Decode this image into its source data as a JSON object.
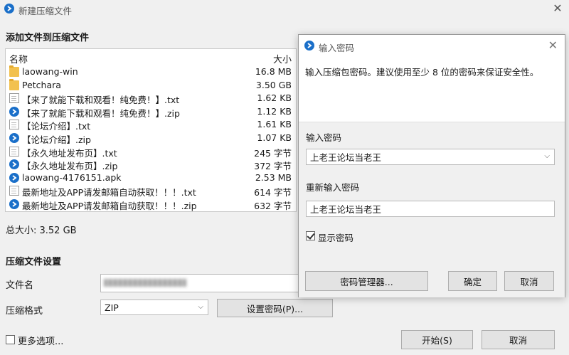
{
  "window": {
    "title": "新建压缩文件",
    "close_glyph": "✕"
  },
  "add_section": {
    "title": "添加文件到压缩文件"
  },
  "file_list": {
    "col_name": "名称",
    "col_size": "大小",
    "rows": [
      {
        "icon": "folder-icon",
        "name": "laowang-win",
        "size": "16.8 MB"
      },
      {
        "icon": "folder-icon",
        "name": "Petchara",
        "size": "3.50 GB"
      },
      {
        "icon": "text-file-icon",
        "name": "【来了就能下载和观看！纯免费！】.txt",
        "size": "1.62 KB"
      },
      {
        "icon": "zip-file-icon",
        "name": "【来了就能下载和观看！纯免费！】.zip",
        "size": "1.12 KB"
      },
      {
        "icon": "text-file-icon",
        "name": "【论坛介绍】.txt",
        "size": "1.61 KB"
      },
      {
        "icon": "zip-file-icon",
        "name": "【论坛介绍】.zip",
        "size": "1.07 KB"
      },
      {
        "icon": "text-file-icon",
        "name": "【永久地址发布页】.txt",
        "size": "245 字节"
      },
      {
        "icon": "zip-file-icon",
        "name": "【永久地址发布页】.zip",
        "size": "372 字节"
      },
      {
        "icon": "apk-file-icon",
        "name": "laowang-4176151.apk",
        "size": "2.53 MB"
      },
      {
        "icon": "text-file-icon",
        "name": "最新地址及APP请发邮箱自动获取！！！.txt",
        "size": "614 字节"
      },
      {
        "icon": "zip-file-icon",
        "name": "最新地址及APP请发邮箱自动获取！！！.zip",
        "size": "632 字节"
      }
    ]
  },
  "total_size": "总大小: 3.52 GB",
  "settings": {
    "title": "压缩文件设置",
    "filename_label": "文件名",
    "format_label": "压缩格式",
    "format_value": "ZIP",
    "set_password_button": "设置密码(P)..."
  },
  "footer": {
    "more_options_label": "更多选项...",
    "start_button": "开始(S)",
    "cancel_button": "取消"
  },
  "password_dialog": {
    "title": "输入密码",
    "close_glyph": "✕",
    "description": "输入压缩包密码。建议使用至少 8 位的密码来保证安全性。",
    "password_label": "输入密码",
    "password_value": "上老王论坛当老王",
    "confirm_label": "重新输入密码",
    "confirm_value": "上老王论坛当老王",
    "show_password_label": "显示密码",
    "show_password_checked": true,
    "manager_button": "密码管理器...",
    "ok_button": "确定",
    "cancel_button": "取消"
  },
  "colors": {
    "accent": "#1a6fc9",
    "folder": "#f2c14e"
  }
}
